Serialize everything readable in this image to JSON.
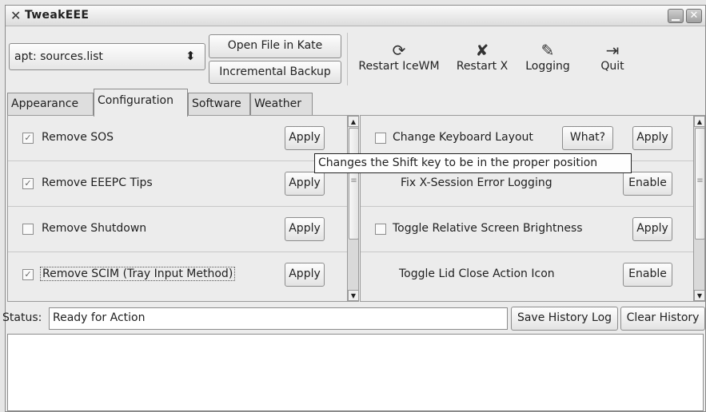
{
  "window": {
    "title": "TweakEEE",
    "title_glyph": "✕"
  },
  "titlebar_buttons": {
    "minimize": "▁",
    "close": "✕"
  },
  "file_select": {
    "value": "apt: sources.list",
    "arrow": "⬍"
  },
  "file_buttons": {
    "open": "Open File in Kate",
    "backup": "Incremental Backup"
  },
  "toolbar": [
    {
      "icon": "restart-icewm-icon",
      "glyph": "⟳",
      "label": "Restart IceWM"
    },
    {
      "icon": "restart-x-icon",
      "glyph": "✘",
      "label": "Restart X"
    },
    {
      "icon": "logging-icon",
      "glyph": "✎",
      "label": "Logging"
    },
    {
      "icon": "quit-icon",
      "glyph": "⇥",
      "label": "Quit"
    }
  ],
  "tabs": [
    "Appearance",
    "Configuration",
    "Software",
    "Weather"
  ],
  "active_tab": "Configuration",
  "left_panel": {
    "rows": [
      {
        "label": "Remove SOS",
        "checked": true,
        "check_glyph": "✓",
        "button": "Apply"
      },
      {
        "label": "Remove EEEPC Tips",
        "checked": true,
        "check_glyph": "✓",
        "button": "Apply"
      },
      {
        "label": "Remove Shutdown",
        "checked": false,
        "check_glyph": "",
        "button": "Apply"
      },
      {
        "label": "Remove SCIM (Tray Input Method)",
        "checked": true,
        "check_glyph": "✓",
        "button": "Apply"
      }
    ]
  },
  "right_panel": {
    "rows": [
      {
        "label": "Change Keyboard Layout",
        "has_checkbox": true,
        "checked": false,
        "extra_button": "What?",
        "button": "Apply"
      },
      {
        "label": "Fix X-Session Error Logging",
        "has_checkbox": false,
        "button": "Enable"
      },
      {
        "label": "Toggle Relative Screen Brightness",
        "has_checkbox": true,
        "checked": false,
        "button": "Apply"
      },
      {
        "label": "Toggle Lid Close Action Icon",
        "has_checkbox": false,
        "button": "Enable"
      }
    ]
  },
  "tooltip": "Changes the Shift key to be in the proper position",
  "status": {
    "label": "Status:",
    "value": "Ready for Action",
    "save_button": "Save History Log",
    "clear_button": "Clear History"
  },
  "scroll_arrows": {
    "up": "▲",
    "down": "▼",
    "grip": "≡"
  },
  "colors": {
    "window_bg": "#ececec",
    "history_bg": "#ffffff",
    "tooltip_bg": "#fefefe"
  }
}
